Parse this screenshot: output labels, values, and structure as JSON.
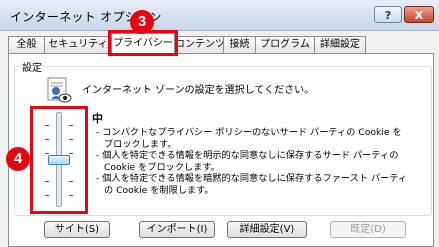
{
  "window": {
    "title": "インターネット オプション",
    "help_label": "?",
    "close_label": "X"
  },
  "tabs": [
    {
      "label": "全般",
      "active": false
    },
    {
      "label": "セキュリティ",
      "active": false
    },
    {
      "label": "プライバシー",
      "active": true
    },
    {
      "label": "コンテンツ",
      "active": false
    },
    {
      "label": "接続",
      "active": false
    },
    {
      "label": "プログラム",
      "active": false
    },
    {
      "label": "詳細設定",
      "active": false
    }
  ],
  "settings": {
    "group_label": "設定",
    "instruction": "インターネット ゾーンの設定を選択してください。",
    "level": "中",
    "level_position": 0.5,
    "descriptions": [
      "- コンパクトなプライバシー ポリシーのないサード パーティの Cookie をブロックします。",
      "- 個人を特定できる情報を明示的な同意なしに保存するサード パーティの Cookie をブロックします。",
      "- 個人を特定できる情報を暗黙的な同意なしに保存するファースト パーティの Cookie を制限します。"
    ]
  },
  "buttons": {
    "sites": "サイト(S)",
    "import": "インポート(I)",
    "advanced": "詳細設定(V)",
    "default": "既定(D)"
  },
  "callouts": {
    "tab_number": "3",
    "slider_number": "4"
  },
  "colors": {
    "highlight": "#e30613"
  }
}
